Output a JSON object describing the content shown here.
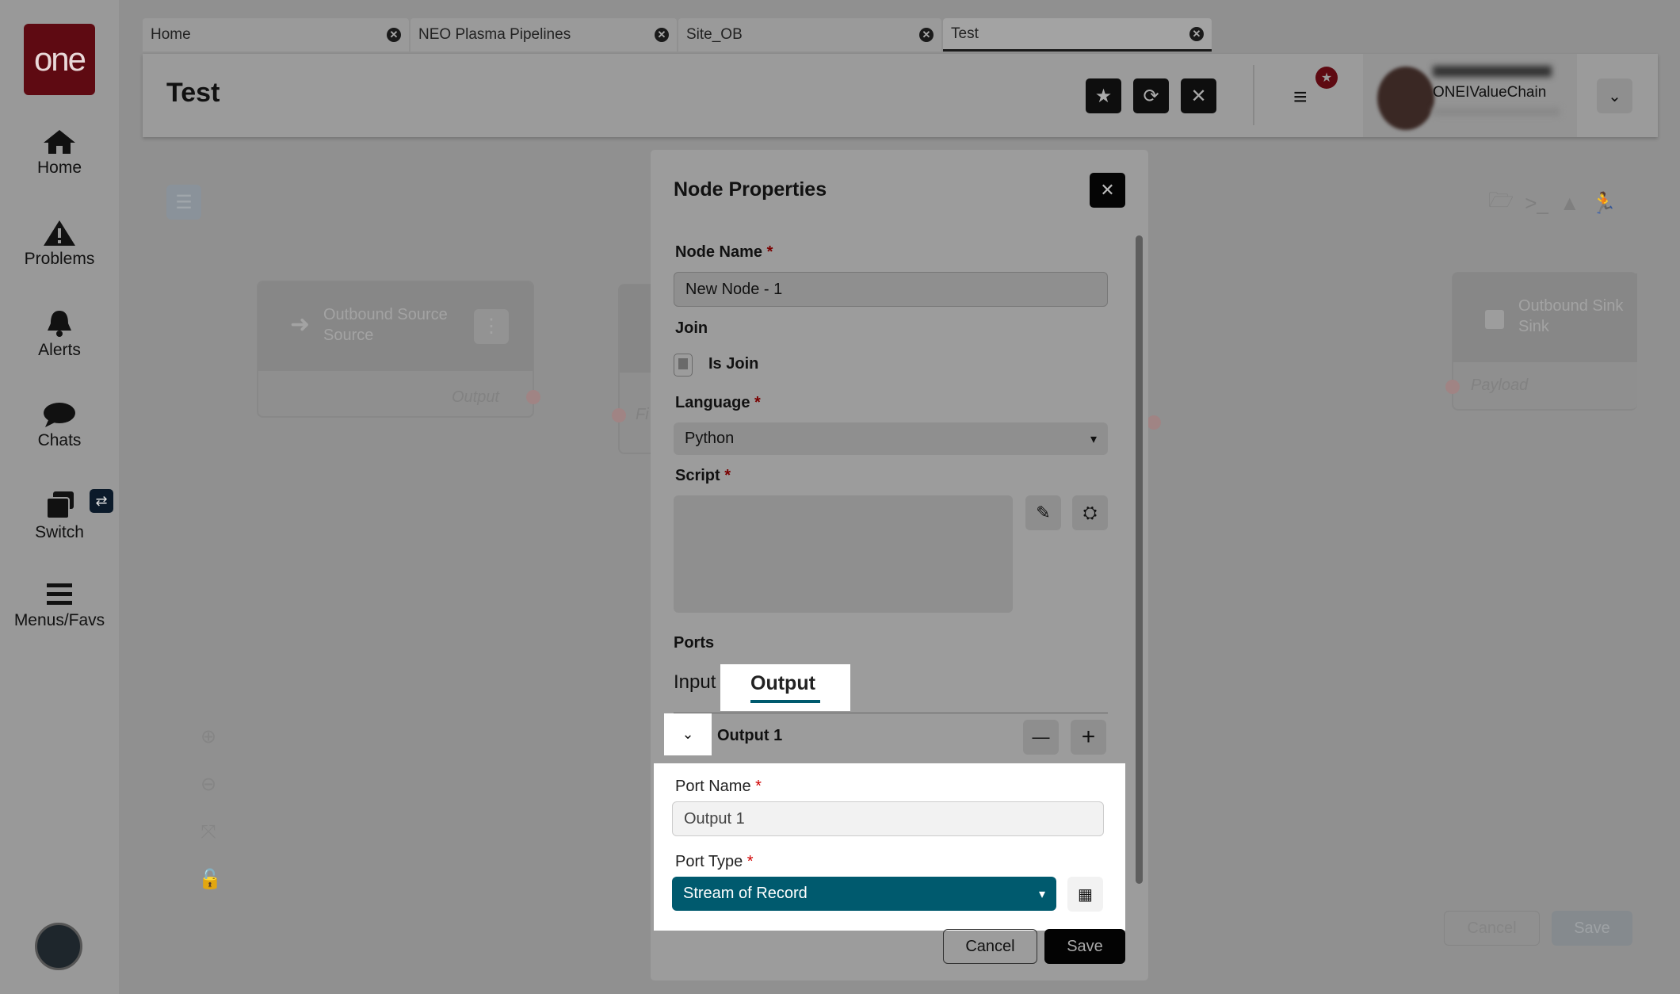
{
  "app": {
    "logo_text": "one"
  },
  "sidebar": {
    "items": [
      {
        "label": "Home",
        "icon": "home-icon"
      },
      {
        "label": "Problems",
        "icon": "warning-icon"
      },
      {
        "label": "Alerts",
        "icon": "bell-icon"
      },
      {
        "label": "Chats",
        "icon": "chat-icon"
      },
      {
        "label": "Switch",
        "icon": "switch-icon"
      },
      {
        "label": "Menus/Favs",
        "icon": "menu-icon"
      }
    ]
  },
  "tabs": [
    {
      "label": "Home",
      "active": false
    },
    {
      "label": "NEO Plasma Pipelines",
      "active": false
    },
    {
      "label": "Site_OB",
      "active": false
    },
    {
      "label": "Test",
      "active": true
    }
  ],
  "header": {
    "title": "Test",
    "user_org": "ONEIValueChain"
  },
  "canvas": {
    "source_node": {
      "title": "Outbound Source",
      "subtitle": "Source",
      "port": "Output"
    },
    "middle_node": {
      "port": "Fi"
    },
    "sink_node": {
      "title": "Outbound Sink",
      "subtitle": "Sink",
      "port": "Payload"
    },
    "cancel_label": "Cancel",
    "save_label": "Save"
  },
  "modal": {
    "title": "Node Properties",
    "node_name_label": "Node Name",
    "node_name_value": "New Node - 1",
    "join_label": "Join",
    "is_join_label": "Is Join",
    "is_join_checked": false,
    "language_label": "Language",
    "language_value": "Python",
    "script_label": "Script",
    "ports_label": "Ports",
    "port_tabs": [
      "Input",
      "Output"
    ],
    "active_port_tab": "Output",
    "port_row_label": "Output 1",
    "port_name_label": "Port Name",
    "port_name_value": "Output 1",
    "port_type_label": "Port Type",
    "port_type_value": "Stream of Record",
    "required_mark": "*",
    "cancel_label": "Cancel",
    "save_label": "Save"
  },
  "colors": {
    "accent": "#005a6e",
    "brand": "#7a0c16",
    "required": "#d00000"
  }
}
